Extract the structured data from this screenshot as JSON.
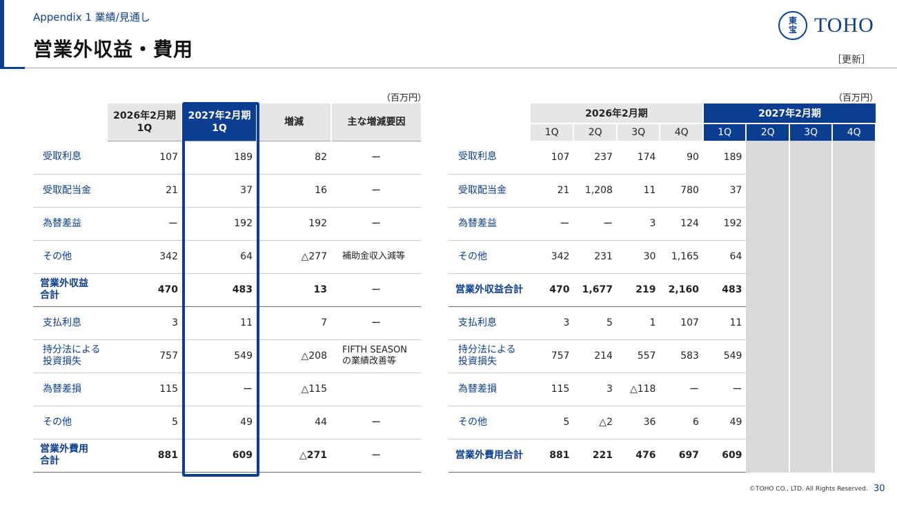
{
  "header": {
    "subtitle": "Appendix 1  業績/見通し",
    "title": "営業外収益・費用",
    "update_label": "［更新］",
    "logo_kanji_top": "東",
    "logo_kanji_bottom": "宝",
    "logo_text": "TOHO"
  },
  "left_table": {
    "unit": "（百万円）",
    "col_prev": "2026年2月期\n1Q",
    "col_curr": "2027年2月期\n1Q",
    "col_diff": "増減",
    "col_factor": "主な増減要因",
    "rows": [
      {
        "label": "受取利息",
        "prev": "107",
        "curr": "189",
        "diff": "82",
        "factor": "ー",
        "total": false
      },
      {
        "label": "受取配当金",
        "prev": "21",
        "curr": "37",
        "diff": "16",
        "factor": "ー",
        "total": false
      },
      {
        "label": "為替差益",
        "prev": "ー",
        "curr": "192",
        "diff": "192",
        "factor": "ー",
        "total": false
      },
      {
        "label": "その他",
        "prev": "342",
        "curr": "64",
        "diff": "△277",
        "factor": "補助金収入減等",
        "total": false
      },
      {
        "label": "営業外収益\n合計",
        "prev": "470",
        "curr": "483",
        "diff": "13",
        "factor": "ー",
        "total": true
      },
      {
        "label": "支払利息",
        "prev": "3",
        "curr": "11",
        "diff": "7",
        "factor": "ー",
        "total": false
      },
      {
        "label": "持分法による\n投資損失",
        "prev": "757",
        "curr": "549",
        "diff": "△208",
        "factor": "FIFTH SEASON\nの業績改善等",
        "total": false
      },
      {
        "label": "為替差損",
        "prev": "115",
        "curr": "ー",
        "diff": "△115",
        "factor": "",
        "total": false
      },
      {
        "label": "その他",
        "prev": "5",
        "curr": "49",
        "diff": "44",
        "factor": "ー",
        "total": false
      },
      {
        "label": "営業外費用\n合計",
        "prev": "881",
        "curr": "609",
        "diff": "△271",
        "factor": "ー",
        "total": true
      }
    ]
  },
  "right_table": {
    "unit": "（百万円）",
    "year_prev": "2026年2月期",
    "year_curr": "2027年2月期",
    "quarters": [
      "1Q",
      "2Q",
      "3Q",
      "4Q",
      "1Q",
      "2Q",
      "3Q",
      "4Q"
    ],
    "rows": [
      {
        "label": "受取利息",
        "values": [
          "107",
          "237",
          "174",
          "90",
          "189"
        ],
        "total": false
      },
      {
        "label": "受取配当金",
        "values": [
          "21",
          "1,208",
          "11",
          "780",
          "37"
        ],
        "total": false
      },
      {
        "label": "為替差益",
        "values": [
          "ー",
          "ー",
          "3",
          "124",
          "192"
        ],
        "total": false
      },
      {
        "label": "その他",
        "values": [
          "342",
          "231",
          "30",
          "1,165",
          "64"
        ],
        "total": false
      },
      {
        "label": "営業外収益合計",
        "values": [
          "470",
          "1,677",
          "219",
          "2,160",
          "483"
        ],
        "total": true
      },
      {
        "label": "支払利息",
        "values": [
          "3",
          "5",
          "1",
          "107",
          "11"
        ],
        "total": false
      },
      {
        "label": "持分法による\n投資損失",
        "values": [
          "757",
          "214",
          "557",
          "583",
          "549"
        ],
        "total": false
      },
      {
        "label": "為替差損",
        "values": [
          "115",
          "3",
          "△118",
          "ー",
          "ー"
        ],
        "total": false
      },
      {
        "label": "その他",
        "values": [
          "5",
          "△2",
          "36",
          "6",
          "49"
        ],
        "total": false
      },
      {
        "label": "営業外費用合計",
        "values": [
          "881",
          "221",
          "476",
          "697",
          "609"
        ],
        "total": true
      }
    ]
  },
  "footer": {
    "copyright": "©TOHO CO., LTD. All Rights Reserved.",
    "page": "30"
  },
  "colors": {
    "brand_blue": "#0b3d91",
    "header_gray": "#e6e6e6",
    "empty_gray": "#d9d9d9"
  }
}
